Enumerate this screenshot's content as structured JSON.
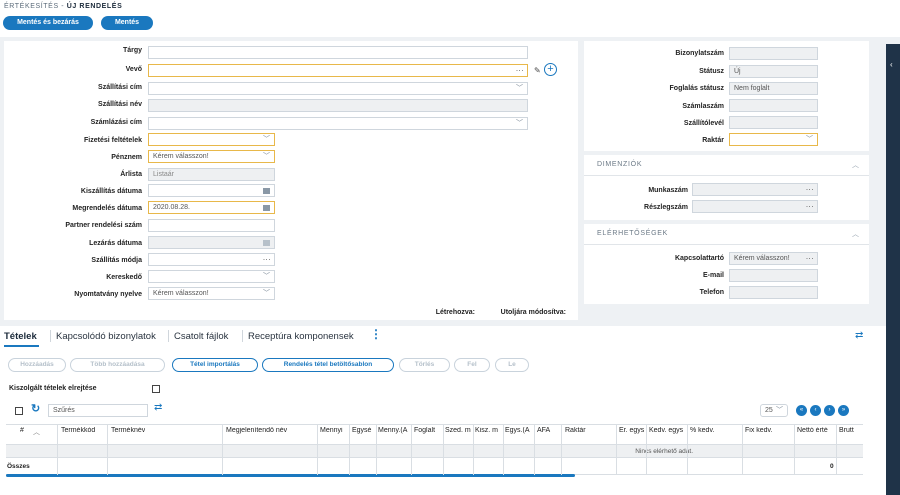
{
  "breadcrumb": {
    "section": "ÉRTÉKESÍTÉS -",
    "current": "ÚJ RENDELÉS"
  },
  "actions": {
    "save_close": "Mentés és bezárás",
    "save": "Mentés"
  },
  "form": {
    "targy": {
      "label": "Tárgy",
      "value": ""
    },
    "vevo": {
      "label": "Vevő",
      "value": ""
    },
    "szallitasi_cim": {
      "label": "Szállítási cím",
      "value": ""
    },
    "szallitasi_nev": {
      "label": "Szállítási név",
      "value": ""
    },
    "szamlazasi_cim": {
      "label": "Számlázási cím",
      "value": ""
    },
    "fizetesi_feltetelek": {
      "label": "Fizetési feltételek",
      "value": ""
    },
    "penznem": {
      "label": "Pénznem",
      "value": "Kérem válasszon!"
    },
    "arlista": {
      "label": "Árlista",
      "value": "Listaár"
    },
    "kiszallitas_datuma": {
      "label": "Kiszállítás dátuma",
      "value": ""
    },
    "megrendeles_datuma": {
      "label": "Megrendelés dátuma",
      "value": "2020.08.28."
    },
    "partner_rendelesi_szam": {
      "label": "Partner rendelési szám",
      "value": ""
    },
    "lezaras_datuma": {
      "label": "Lezárás dátuma",
      "value": ""
    },
    "szallitas_modja": {
      "label": "Szállítás módja",
      "value": ""
    },
    "kereskedo": {
      "label": "Kereskedő",
      "value": ""
    },
    "nyomtatvany_nyelve": {
      "label": "Nyomtatvány nyelve",
      "value": "Kérem válasszon!"
    },
    "letrehozva": "Létrehozva:",
    "utoljara_modositva": "Utoljára módosítva:"
  },
  "status_panel": {
    "bizonylatszam": {
      "label": "Bizonylatszám",
      "value": ""
    },
    "statusz": {
      "label": "Státusz",
      "value": "Új"
    },
    "foglalas_statusz": {
      "label": "Foglalás státusz",
      "value": "Nem foglalt"
    },
    "szamlaszam": {
      "label": "Számlaszám",
      "value": ""
    },
    "szallitolevel": {
      "label": "Szállítólevél",
      "value": ""
    },
    "raktar": {
      "label": "Raktár",
      "value": ""
    }
  },
  "dimensions": {
    "title": "DIMENZIÓK",
    "munkaszam": {
      "label": "Munkaszám",
      "value": ""
    },
    "reszlegszam": {
      "label": "Részlegszám",
      "value": ""
    }
  },
  "contacts": {
    "title": "ELÉRHETŐSÉGEK",
    "kapcsolattarto": {
      "label": "Kapcsolattartó",
      "value": "Kérem válasszon!"
    },
    "email": {
      "label": "E-mail",
      "value": ""
    },
    "telefon": {
      "label": "Telefon",
      "value": ""
    }
  },
  "tabs": [
    "Tételek",
    "Kapcsolódó bizonylatok",
    "Csatolt fájlok",
    "Receptúra komponensek"
  ],
  "item_buttons": [
    "Hozzáadás",
    "Több hozzáadása",
    "Tétel importálás",
    "Rendelés tétel betöltősablon",
    "Törlés",
    "Fel",
    "Le"
  ],
  "hide_delivered": {
    "label": "Kiszolgált tételek elrejtése",
    "checked": false
  },
  "filter": {
    "placeholder": "Szűrés"
  },
  "page_size": "25",
  "table": {
    "columns": [
      "#",
      "Termékkód",
      "Terméknév",
      "Megjelenítendő név",
      "Mennyi",
      "Egysé",
      "Menny.(A",
      "Foglalt",
      "Szed. m",
      "Kisz. m",
      "Egys.(A",
      "ÁFA",
      "Raktár",
      "Er. egys",
      "Kedv. egys",
      "% kedv.",
      "Fix kedv.",
      "Nettó érté",
      "Brutt"
    ],
    "empty_message": "Nincs elérhető adat.",
    "footer_label": "Összes",
    "footer_total": "0"
  },
  "colors": {
    "accent": "#1a78bf",
    "highlight_border": "#e8b84a",
    "sidebar": "#1f3348"
  }
}
